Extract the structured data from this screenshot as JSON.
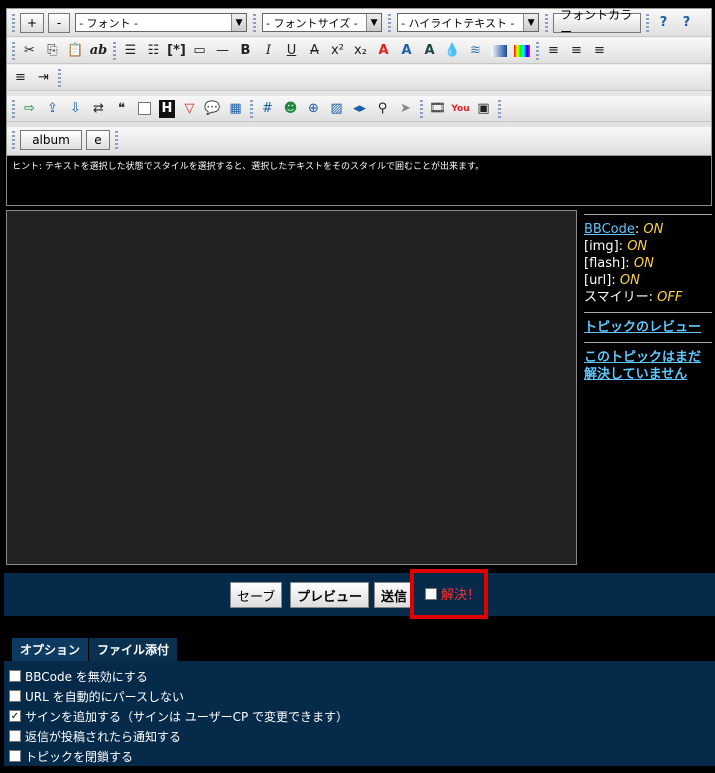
{
  "toolbar": {
    "row1": {
      "plus": "+",
      "minus": "-",
      "font_select": "- フォント -",
      "size_select": "- フォントサイズ -",
      "highlight_select": "- ハイライトテキスト -",
      "font_color_btn": "フォントカラー"
    },
    "row2_text_icons": {
      "bold": "B",
      "italic": "I",
      "underline": "U",
      "strike": "A",
      "sup": "x²",
      "sub": "x₂",
      "ab": "ab"
    },
    "row5": {
      "album": "album",
      "e": "e"
    }
  },
  "hint": "ヒント: テキストを選択した状態でスタイルを選択すると、選択したテキストをそのスタイルで囲むことが出来ます。",
  "side": {
    "bbcode_label": "BBCode",
    "bbcode_val": "ON",
    "img_label": "[img]:",
    "img_val": "ON",
    "flash_label": "[flash]:",
    "flash_val": "ON",
    "url_label": "[url]:",
    "url_val": "ON",
    "smiley_label": "スマイリー:",
    "smiley_val": "OFF",
    "review_link": "トピックのレビュー",
    "unsolved_link": "このトピックはまだ解決していません"
  },
  "submit": {
    "save": "セーブ",
    "preview": "プレビュー",
    "send": "送信",
    "solve": "解決！"
  },
  "tabs": [
    "オプション",
    "ファイル添付"
  ],
  "options": [
    {
      "label": "BBCode を無効にする",
      "checked": false
    },
    {
      "label": "URL を自動的にパースしない",
      "checked": false
    },
    {
      "label": "サインを追加する（サインは ユーザーCP で変更できます）",
      "checked": true
    },
    {
      "label": "返信が投稿されたら通知する",
      "checked": false
    },
    {
      "label": "トピックを閉鎖する",
      "checked": false
    }
  ],
  "colors": {
    "panel_bg": "#052a4a",
    "link": "#5ec8ff",
    "on": "#ffd24a",
    "highlight": "#e00000"
  }
}
